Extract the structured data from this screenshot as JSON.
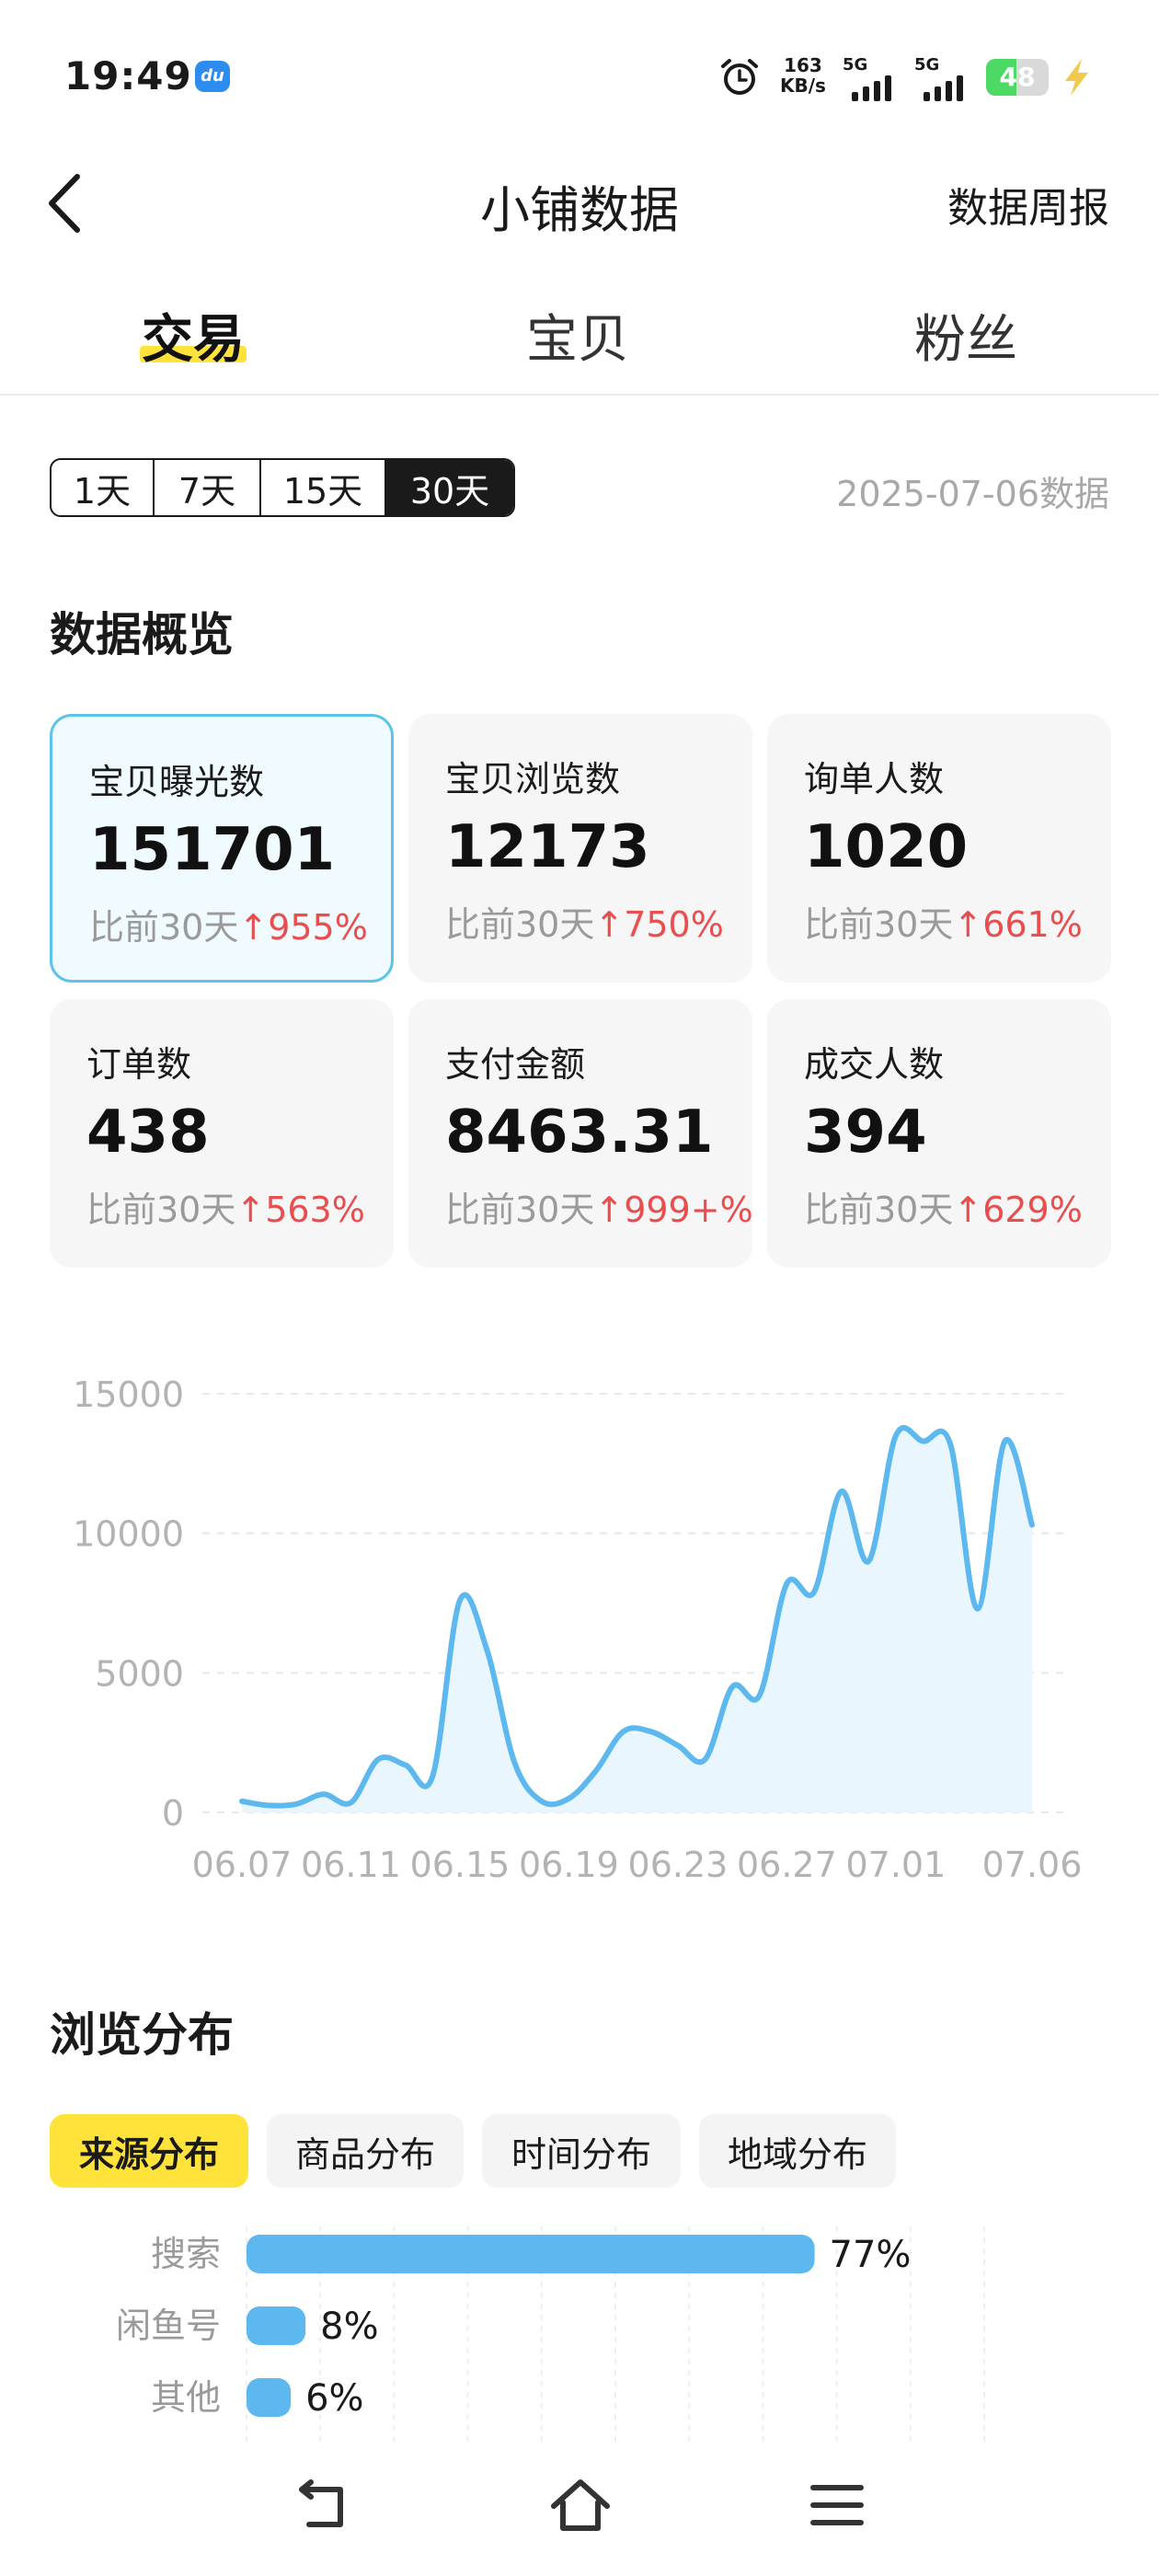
{
  "status_bar": {
    "time": "19:49",
    "app_badge": "du",
    "net_speed_value": "163",
    "net_speed_unit": "KB/s",
    "signal1_label": "5G",
    "signal2_label": "5G",
    "battery_level": "48",
    "battery_fraction": 0.48,
    "icons": [
      "alarm-icon",
      "signal-icon",
      "battery-icon",
      "charging-bolt-icon"
    ]
  },
  "header": {
    "title": "小铺数据",
    "right_link": "数据周报",
    "back_icon": "chevron-left-icon"
  },
  "tabs": [
    {
      "label": "交易",
      "active": true
    },
    {
      "label": "宝贝",
      "active": false
    },
    {
      "label": "粉丝",
      "active": false
    }
  ],
  "range": {
    "options": [
      "1天",
      "7天",
      "15天",
      "30天"
    ],
    "selected": "30天",
    "date_label": "2025-07-06数据"
  },
  "overview": {
    "title": "数据概览",
    "cards": [
      {
        "label": "宝贝曝光数",
        "value": "151701",
        "compare": "比前30天",
        "change": "955%",
        "selected": true
      },
      {
        "label": "宝贝浏览数",
        "value": "12173",
        "compare": "比前30天",
        "change": "750%",
        "selected": false
      },
      {
        "label": "询单人数",
        "value": "1020",
        "compare": "比前30天",
        "change": "661%",
        "selected": false
      },
      {
        "label": "订单数",
        "value": "438",
        "compare": "比前30天",
        "change": "563%",
        "selected": false
      },
      {
        "label": "支付金额",
        "value": "8463.31",
        "compare": "比前30天",
        "change": "999+%",
        "selected": false
      },
      {
        "label": "成交人数",
        "value": "394",
        "compare": "比前30天",
        "change": "629%",
        "selected": false
      }
    ],
    "up_arrow": "↑",
    "accent_up_color": "#e84e4e"
  },
  "chart_data": [
    {
      "type": "area",
      "title": "",
      "xlabel": "",
      "ylabel": "",
      "ylim": [
        0,
        15000
      ],
      "yticks": [
        "0",
        "5000",
        "10000",
        "15000"
      ],
      "xticks": [
        "06.07",
        "06.11",
        "06.15",
        "06.19",
        "06.23",
        "06.27",
        "07.01",
        "07.06"
      ],
      "grid": true,
      "color": "#5cb8ee",
      "x": [
        "06.07",
        "06.08",
        "06.09",
        "06.10",
        "06.11",
        "06.12",
        "06.13",
        "06.14",
        "06.15",
        "06.16",
        "06.17",
        "06.18",
        "06.19",
        "06.20",
        "06.21",
        "06.22",
        "06.23",
        "06.24",
        "06.25",
        "06.26",
        "06.27",
        "06.28",
        "06.29",
        "06.30",
        "07.01",
        "07.02",
        "07.03",
        "07.04",
        "07.05",
        "07.06"
      ],
      "values": [
        400,
        250,
        300,
        650,
        350,
        1900,
        1700,
        1300,
        7600,
        5800,
        1800,
        400,
        500,
        1500,
        2900,
        2900,
        2400,
        1900,
        4500,
        4200,
        8200,
        7900,
        11500,
        9000,
        13500,
        13300,
        13200,
        7300,
        13300,
        10300
      ]
    },
    {
      "type": "bar",
      "orientation": "horizontal",
      "categories": [
        "搜索",
        "闲鱼号",
        "其他"
      ],
      "values": [
        77,
        8,
        6
      ],
      "value_labels": [
        "77%",
        "8%",
        "6%"
      ],
      "xlim": [
        0,
        100
      ],
      "color": "#5cb8ee"
    }
  ],
  "browse": {
    "title": "浏览分布",
    "tabs": [
      {
        "label": "来源分布",
        "active": true
      },
      {
        "label": "商品分布",
        "active": false
      },
      {
        "label": "时间分布",
        "active": false
      },
      {
        "label": "地域分布",
        "active": false
      }
    ],
    "active_color": "#ffe33a"
  },
  "nav_bar": {
    "icons": [
      "nav-back-icon",
      "nav-home-icon",
      "nav-menu-icon"
    ]
  }
}
